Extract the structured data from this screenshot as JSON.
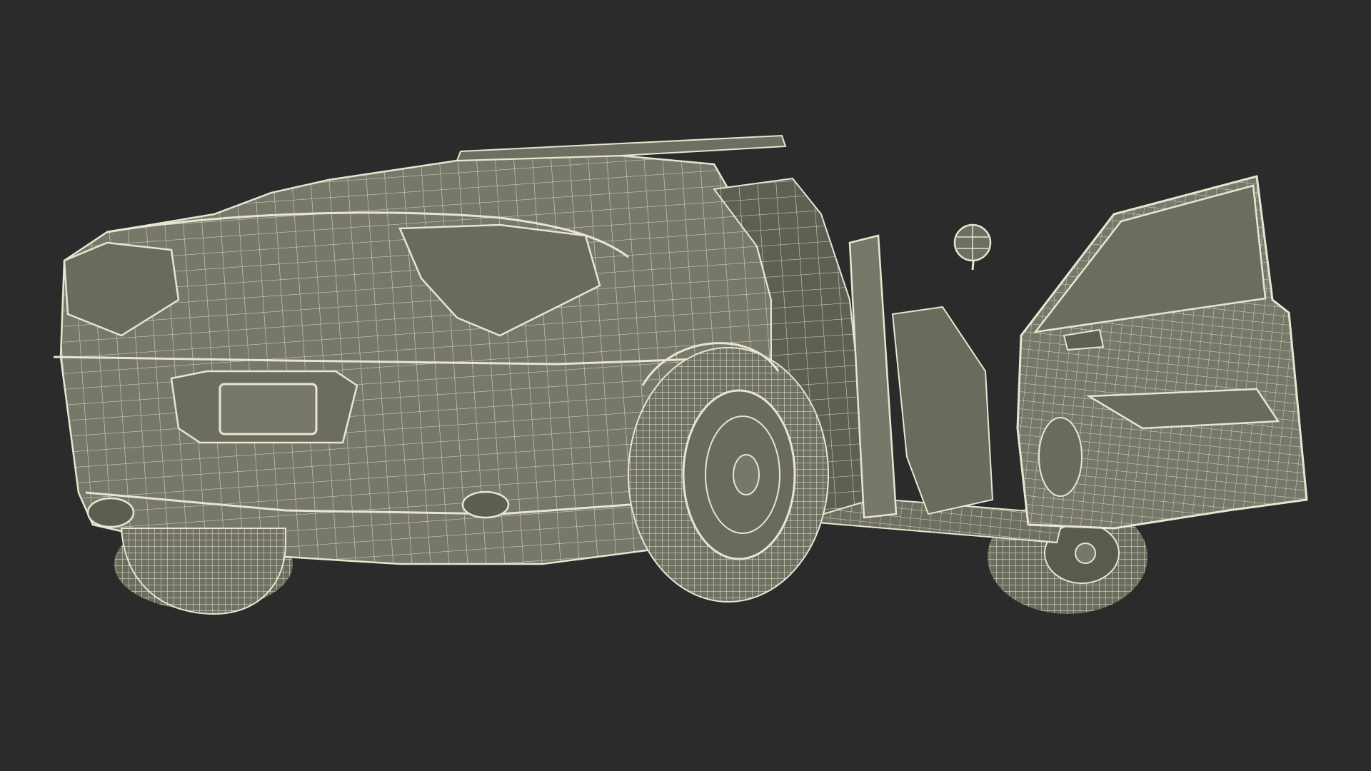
{
  "scene": {
    "subject": "car-wireframe-model",
    "colors": {
      "background": "#2b2b2b",
      "body_fill": "#777869",
      "body_fill_dark": "#5f6054",
      "wire": "#e6e6d3",
      "shadow": "#4d4e44"
    }
  }
}
